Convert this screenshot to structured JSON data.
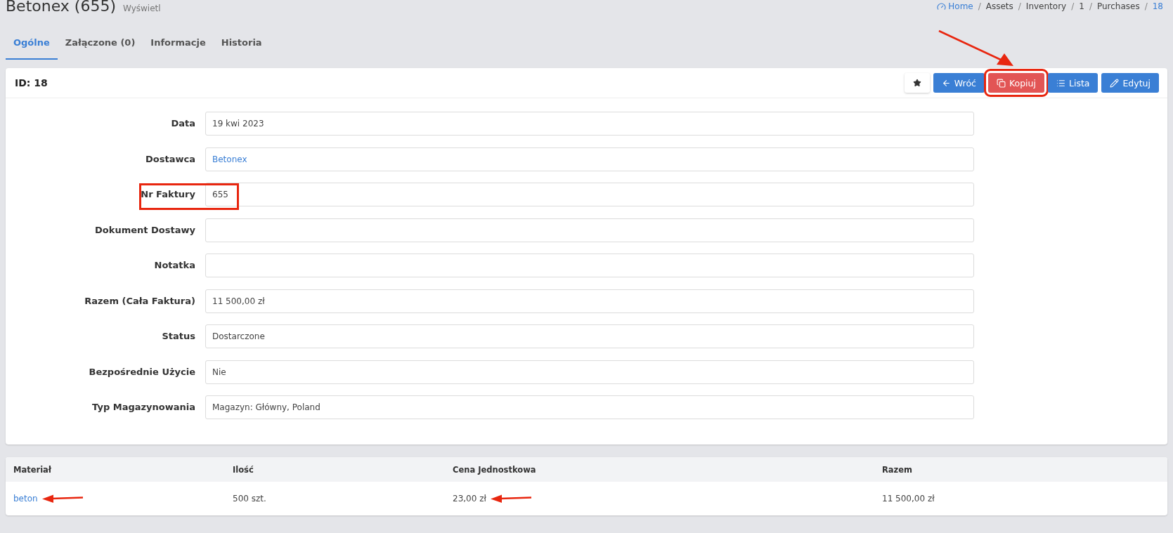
{
  "page": {
    "title": "Betonex (655)",
    "subtitle": "Wyświetl"
  },
  "breadcrumb_separator": "/",
  "breadcrumb": [
    {
      "label": "Home",
      "kind": "home"
    },
    {
      "label": "Assets",
      "kind": "plain"
    },
    {
      "label": "Inventory",
      "kind": "plain"
    },
    {
      "label": "1",
      "kind": "plain"
    },
    {
      "label": "Purchases",
      "kind": "plain"
    },
    {
      "label": "18",
      "kind": "current"
    }
  ],
  "tabs": [
    {
      "label": "Ogólne",
      "selected": true
    },
    {
      "label": "Załączone (0)",
      "selected": false
    },
    {
      "label": "Informacje",
      "selected": false
    },
    {
      "label": "Historia",
      "selected": false
    }
  ],
  "record": {
    "heading": "ID: 18",
    "actions": [
      {
        "kind": "favorite",
        "highlighted": false
      },
      {
        "kind": "back",
        "label": "Wróć",
        "highlighted": false
      },
      {
        "kind": "copy",
        "label": "Kopiuj",
        "highlighted": true
      },
      {
        "kind": "list",
        "label": "Lista",
        "highlighted": false
      },
      {
        "kind": "edit",
        "label": "Edytuj",
        "highlighted": false
      }
    ],
    "fields": [
      {
        "label": "Data",
        "value": "19 kwi 2023",
        "link": false,
        "highlighted": false
      },
      {
        "label": "Dostawca",
        "value": "Betonex",
        "link": true,
        "highlighted": false
      },
      {
        "label": "Nr Faktury",
        "value": "655",
        "link": false,
        "highlighted": true
      },
      {
        "label": "Dokument Dostawy",
        "highlighted": false
      },
      {
        "label": "Notatka",
        "highlighted": false
      },
      {
        "label": "Razem (Cała Faktura)",
        "value": "11 500,00 zł",
        "link": false,
        "highlighted": false
      },
      {
        "label": "Status",
        "value": "Dostarczone",
        "link": false,
        "highlighted": false
      },
      {
        "label": "Bezpośrednie Użycie",
        "value": "Nie",
        "link": false,
        "highlighted": false
      },
      {
        "label": "Typ Magazynowania",
        "value": "Magazyn: Główny, Poland",
        "link": false,
        "highlighted": false
      }
    ]
  },
  "table": {
    "columns": [
      "Materiał",
      "Ilość",
      "Cena Jednostkowa",
      "Razem"
    ],
    "rows": [
      {
        "cells": [
          {
            "text": "beton",
            "link": true,
            "pointed": true
          },
          {
            "text": "500 szt.",
            "link": false,
            "pointed": false
          },
          {
            "text": "23,00 zł",
            "link": false,
            "pointed": true
          },
          {
            "text": "11 500,00 zł",
            "link": false,
            "pointed": false
          }
        ]
      }
    ]
  }
}
